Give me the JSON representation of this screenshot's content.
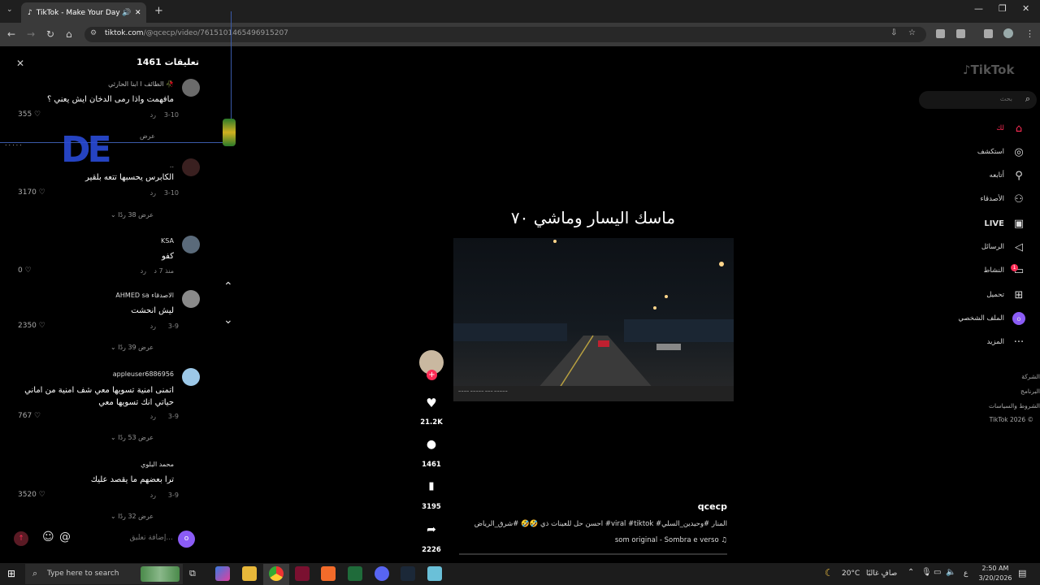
{
  "browser": {
    "tab_title": "TikTok - Make Your Day",
    "url_host": "tiktok.com",
    "url_path": "/@qcecp/video/7615101465496915207"
  },
  "comments_panel": {
    "title": "تعليقات 1461",
    "reply_label": "رد",
    "comments": [
      {
        "name": "ابنا الحارثي l الطائف 🥀",
        "text": "مافهمت واذا رمى الدخان ايش يعني ؟",
        "date": "3-10",
        "likes": "355",
        "more": "عرض"
      },
      {
        "name": "..",
        "text": "الكابرس يحسبها تتعه بلقير",
        "date": "3-10",
        "likes": "3170",
        "more": "عرض 38 ردًا"
      },
      {
        "name": "KSA",
        "text": "كفو",
        "date": "منذ 7 د",
        "likes": "0",
        "more": ""
      },
      {
        "name": "AHMED sa الاصدقاء",
        "text": "ليش انحشت",
        "date": "3-9",
        "likes": "2350",
        "more": "عرض 39 ردًا"
      },
      {
        "name": "appleuser6886956",
        "text": "اتمنى امنية تسويها معي شف امنية من اماني حياتي انك تسويها معي",
        "date": "3-9",
        "likes": "767",
        "more": "عرض 53 ردًا"
      },
      {
        "name": "محمد البلوي",
        "text": "ترا بعضهم ما يقصد عليك",
        "date": "3-9",
        "likes": "3520",
        "more": "عرض 32 ردًا"
      }
    ],
    "input_placeholder": "إضافة تعليق..."
  },
  "video": {
    "overlay_title": "ماسك اليسار وماشي ٧٠",
    "author": "qcecp",
    "caption": "احسن حل للعينات ذي 🤣🤣 #شرق_الرياض #viral #tiktok #المنار #وحيدين_السلي",
    "music": "som original - Sombra e verso"
  },
  "actions": {
    "likes": "21.2K",
    "comments": "1461",
    "saves": "3195",
    "shares": "2226"
  },
  "sidebar": {
    "logo": "TikTok",
    "search_placeholder": "بحث",
    "items": [
      {
        "label": "لك",
        "icon": "home-icon"
      },
      {
        "label": "استكشف",
        "icon": "compass-icon"
      },
      {
        "label": "أتابعه",
        "icon": "following-icon"
      },
      {
        "label": "الأصدقاء",
        "icon": "friends-icon"
      },
      {
        "label": "LIVE",
        "icon": "live-icon"
      },
      {
        "label": "الرسائل",
        "icon": "send-icon"
      },
      {
        "label": "النشاط",
        "icon": "activity-icon"
      },
      {
        "label": "تحميل",
        "icon": "upload-icon"
      },
      {
        "label": "الملف الشخصي",
        "icon": "profile-icon"
      },
      {
        "label": "المزيد",
        "icon": "more-icon"
      }
    ],
    "activity_badge": "1",
    "footer": [
      "الشركة",
      "البرنامج",
      "الشروط والسياسات",
      "TikTok 2026 ©"
    ]
  },
  "taskbar": {
    "search_placeholder": "Type here to search",
    "weather": "20°C",
    "weather_text": "صافٍ غالبًا",
    "lang": "ع",
    "time": "2:50 AM",
    "date": "3/20/2026"
  },
  "colors": {
    "accent": "#fe2c55",
    "profile": "#8b5cf6",
    "panel": "#000000"
  }
}
